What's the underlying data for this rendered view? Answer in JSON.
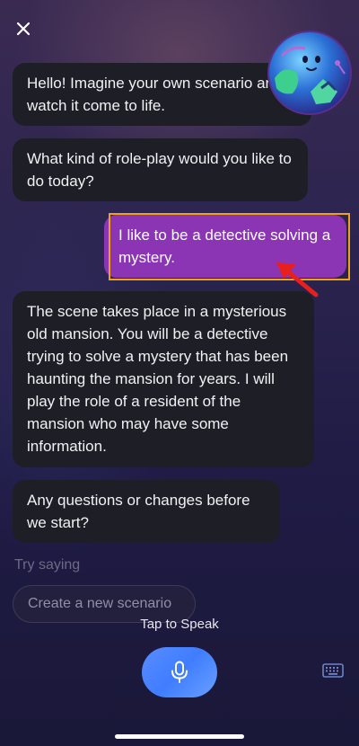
{
  "chat": {
    "messages": [
      {
        "role": "assistant",
        "text": "Hello! Imagine your own scenario and watch it come to life."
      },
      {
        "role": "assistant",
        "text": "What kind of role-play would you like to do today?"
      },
      {
        "role": "user",
        "text": "I like to be a detective solving a mystery."
      },
      {
        "role": "assistant",
        "text": "The scene takes place in a mysterious old mansion. You will be a detective trying to solve a mystery that has been haunting the mansion for years. I will play the role of a resident of the mansion who may have some information."
      },
      {
        "role": "assistant",
        "text": "Any questions or changes before we start?"
      }
    ]
  },
  "suggestions": {
    "label": "Try saying",
    "items": [
      "Create a new scenario"
    ]
  },
  "voice": {
    "tap_label": "Tap to Speak"
  },
  "icons": {
    "close": "close-icon",
    "mic": "microphone-icon",
    "keyboard": "keyboard-icon",
    "avatar": "globe-mascot-avatar"
  },
  "colors": {
    "user_bubble": "#8b35b5",
    "assistant_bubble": "#1e1e26",
    "highlight": "#f3a019",
    "arrow": "#e8201d",
    "mic_button": "#4a88ff"
  }
}
